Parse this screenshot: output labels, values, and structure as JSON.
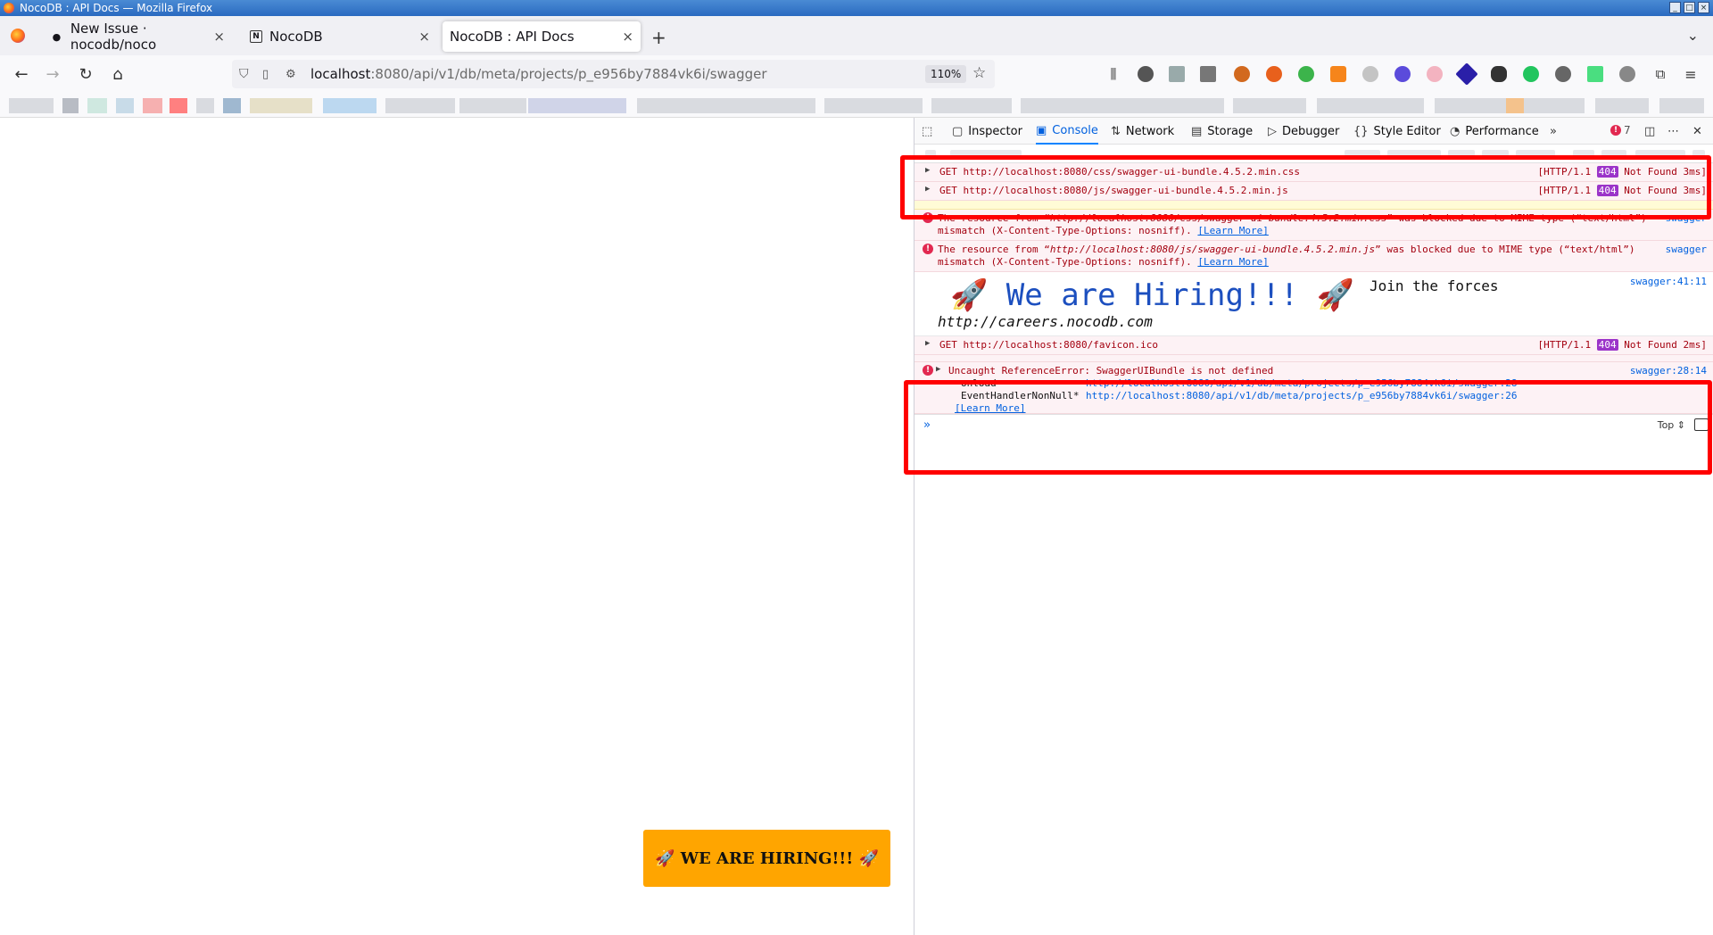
{
  "window": {
    "title": "NocoDB : API Docs — Mozilla Firefox",
    "controls": [
      "minimize",
      "maximize",
      "close"
    ]
  },
  "tabs": [
    {
      "label": "New Issue · nocodb/noco",
      "icon": "github-icon",
      "active": false
    },
    {
      "label": "NocoDB",
      "icon": "nocodb-icon",
      "active": false
    },
    {
      "label": "NocoDB : API Docs",
      "icon": "",
      "active": true
    }
  ],
  "navbar": {
    "url_host": "localhost",
    "url_path": ":8080/api/v1/db/meta/projects/p_e956by7884vk6i/swagger",
    "zoom": "110%"
  },
  "page": {
    "hiring_button": "🚀 WE ARE HIRING!!! 🚀"
  },
  "devtools": {
    "tabs": [
      "Inspector",
      "Console",
      "Network",
      "Storage",
      "Debugger",
      "Style Editor",
      "Performance"
    ],
    "active_tab": "Console",
    "error_count": "7",
    "console": {
      "req1": {
        "method": "GET",
        "url": "http://localhost:8080/css/swagger-ui-bundle.4.5.2.min.css",
        "proto": "[HTTP/1.1",
        "status": "404",
        "status_text": "Not Found 3ms]"
      },
      "req2": {
        "method": "GET",
        "url": "http://localhost:8080/js/swagger-ui-bundle.4.5.2.min.js",
        "proto": "[HTTP/1.1",
        "status": "404",
        "status_text": "Not Found 3ms]"
      },
      "mime1": {
        "line1_a": "The resource from “",
        "line1_url": "http://localhost:8080/css/swagger-ui-bundle.4.5.2.min.css",
        "line1_b": "” was blocked due to MIME type (“text/html”)",
        "line2": "mismatch (X-Content-Type-Options: nosniff).",
        "learn_more": "[Learn More]",
        "source": "swagger"
      },
      "mime2": {
        "line1_a": "The resource from “",
        "line1_url": "http://localhost:8080/js/swagger-ui-bundle.4.5.2.min.js",
        "line1_b": "” was blocked due to MIME type (“text/html”)",
        "line2": "mismatch (X-Content-Type-Options: nosniff).",
        "learn_more": "[Learn More]",
        "source": "swagger"
      },
      "hiring": {
        "headline": "🚀 We are Hiring!!! 🚀",
        "join": "Join the forces",
        "careers": "http://careers.nocodb.com",
        "source": "swagger:41:11"
      },
      "req3": {
        "method": "GET",
        "url": "http://localhost:8080/favicon.ico",
        "proto": "[HTTP/1.1",
        "status": "404",
        "status_text": "Not Found 2ms]"
      },
      "error": {
        "message": "Uncaught ReferenceError: SwaggerUIBundle is not defined",
        "source": "swagger:28:14",
        "stack": [
          {
            "fn": "onload",
            "loc": "http://localhost:8080/api/v1/db/meta/projects/p_e956by7884vk6i/swagger:28"
          },
          {
            "fn": "EventHandlerNonNull*",
            "loc": "http://localhost:8080/api/v1/db/meta/projects/p_e956by7884vk6i/swagger:26"
          }
        ],
        "learn_more": "[Learn More]"
      },
      "context": "Top ⇕"
    }
  },
  "highlight_color": "#ff0000"
}
